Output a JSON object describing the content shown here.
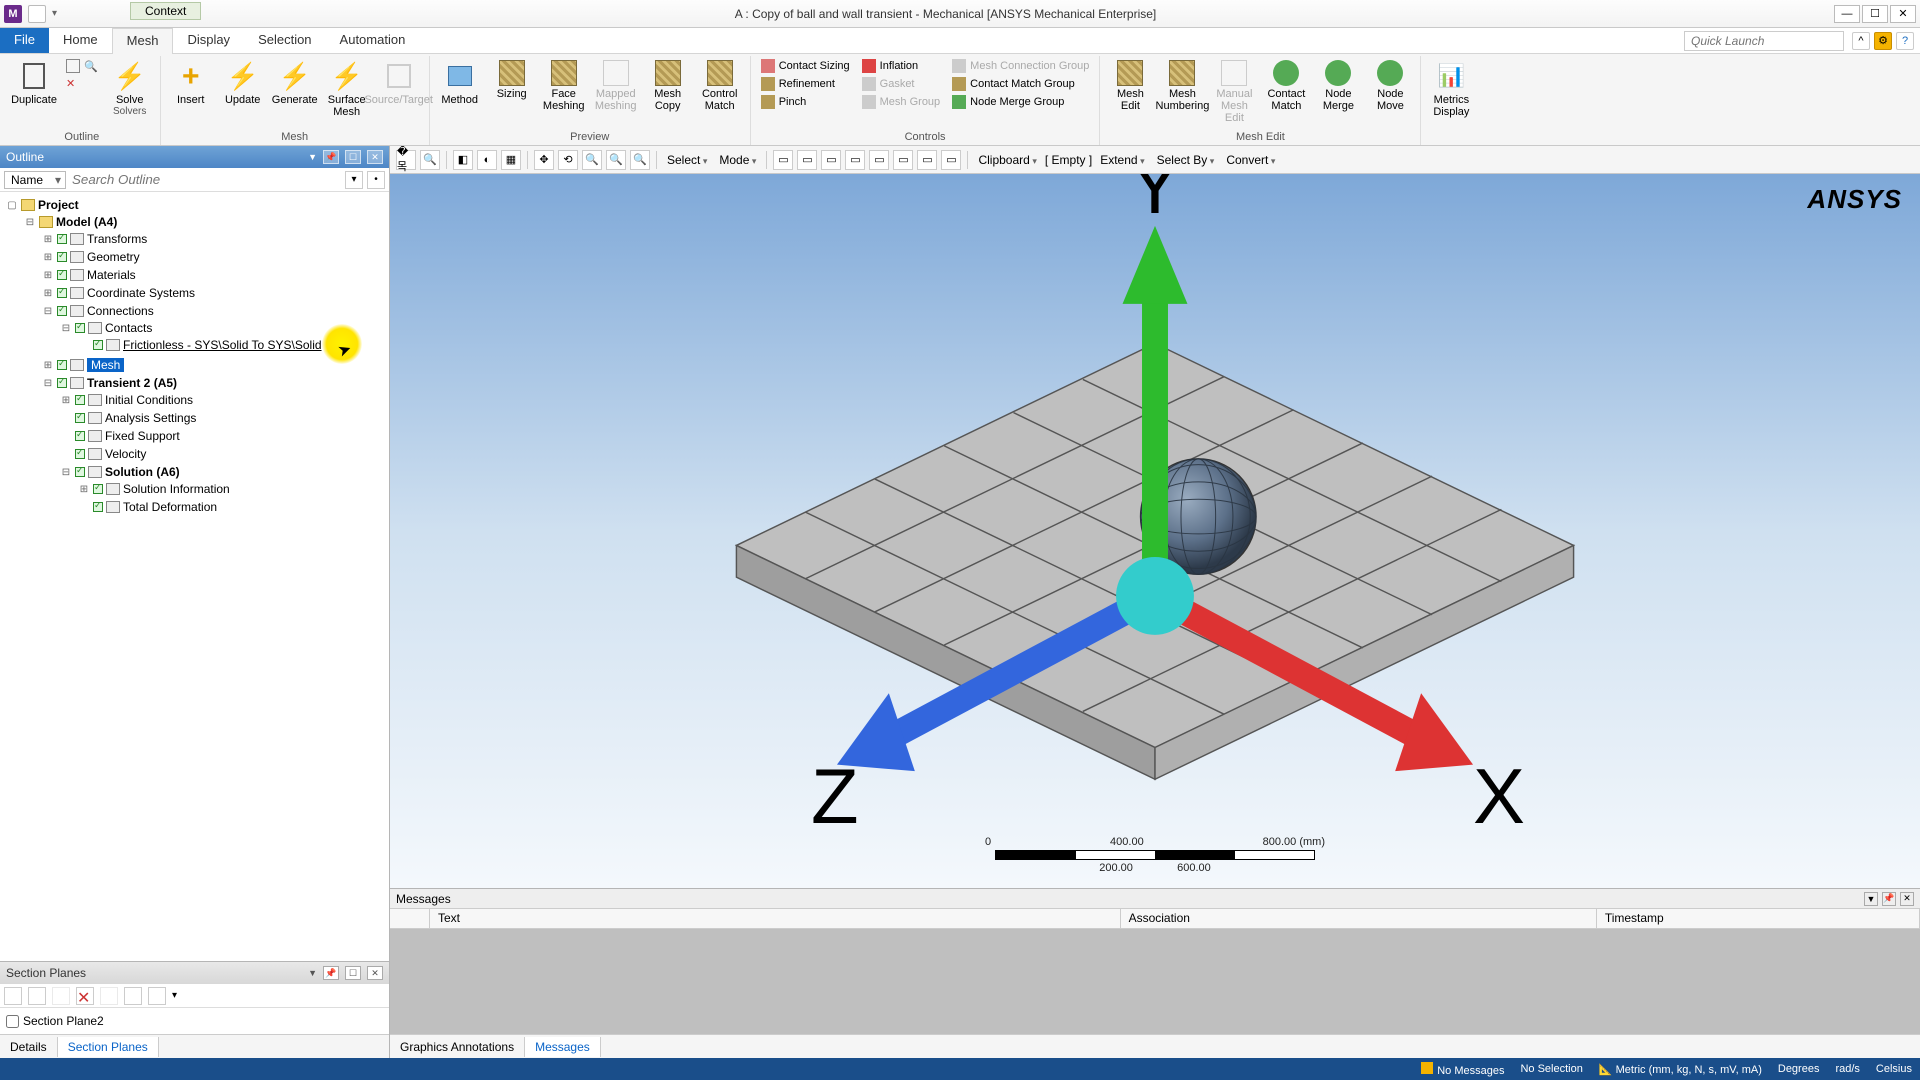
{
  "app": {
    "icon_letter": "M",
    "title": "A : Copy of ball and wall transient - Mechanical [ANSYS Mechanical Enterprise]",
    "context_tab": "Context"
  },
  "tabs": {
    "file": "File",
    "items": [
      "Home",
      "Mesh",
      "Display",
      "Selection",
      "Automation"
    ],
    "active": "Mesh",
    "quick_launch_placeholder": "Quick Launch"
  },
  "ribbon": {
    "outline_group": {
      "duplicate": "Duplicate",
      "q": "Q",
      "solve": "Solve",
      "solvers": "Solvers",
      "label": "Outline"
    },
    "mesh_group": {
      "insert": "Insert",
      "update": "Update",
      "generate": "Generate",
      "surface_mesh": "Surface Mesh",
      "source_target": "Source/Target",
      "label": "Mesh"
    },
    "preview_group": {
      "method": "Method",
      "sizing": "Sizing",
      "face_meshing": "Face Meshing",
      "mapped_meshing": "Mapped Meshing",
      "mesh_copy": "Mesh Copy",
      "control_match": "Control Match",
      "label": "Preview"
    },
    "controls_group": {
      "contact_sizing": "Contact Sizing",
      "refinement": "Refinement",
      "pinch": "Pinch",
      "inflation": "Inflation",
      "gasket": "Gasket",
      "mesh_group": "Mesh Group",
      "mesh_connection_group": "Mesh Connection Group",
      "contact_match_group": "Contact Match Group",
      "node_merge_group": "Node Merge Group",
      "label": "Controls"
    },
    "mesh_edit_group": {
      "mesh_edit": "Mesh Edit",
      "mesh_numbering": "Mesh Numbering",
      "manual_mesh_edit": "Manual Mesh Edit",
      "contact_match": "Contact Match",
      "node_merge": "Node Merge",
      "node_move": "Node Move",
      "label": "Mesh Edit"
    },
    "metrics": {
      "metrics_display": "Metrics Display"
    }
  },
  "outline": {
    "title": "Outline",
    "name_label": "Name",
    "search_placeholder": "Search Outline",
    "project": "Project",
    "model": "Model (A4)",
    "transforms": "Transforms",
    "geometry": "Geometry",
    "materials": "Materials",
    "coord": "Coordinate Systems",
    "connections": "Connections",
    "contacts": "Contacts",
    "frictionless": "Frictionless - SYS\\Solid To SYS\\Solid",
    "mesh": "Mesh",
    "transient": "Transient 2 (A5)",
    "initial": "Initial Conditions",
    "analysis": "Analysis Settings",
    "fixed": "Fixed Support",
    "velocity": "Velocity",
    "solution": "Solution (A6)",
    "solinfo": "Solution Information",
    "totaldef": "Total Deformation"
  },
  "section_planes": {
    "title": "Section Planes",
    "item": "Section Plane2"
  },
  "left_tabs": {
    "details": "Details",
    "section_planes": "Section Planes"
  },
  "view_toolbar": {
    "select": "Select",
    "mode": "Mode",
    "clipboard": "Clipboard",
    "empty": "[ Empty ]",
    "extend": "Extend",
    "select_by": "Select By",
    "convert": "Convert"
  },
  "viewport": {
    "logo": "ANSYS",
    "scale": {
      "t0": "0",
      "t200": "200.00",
      "t400": "400.00",
      "t600": "600.00",
      "t800": "800.00 (mm)"
    },
    "triad": {
      "x": "X",
      "y": "Y",
      "z": "Z"
    }
  },
  "messages": {
    "title": "Messages",
    "col_blank": " ",
    "col_text": "Text",
    "col_assoc": "Association",
    "col_time": "Timestamp",
    "tab_graphics": "Graphics Annotations",
    "tab_messages": "Messages"
  },
  "status": {
    "no_messages": "No Messages",
    "no_selection": "No Selection",
    "units": "Metric (mm, kg, N, s, mV, mA)",
    "degrees": "Degrees",
    "rads": "rad/s",
    "celsius": "Celsius"
  }
}
